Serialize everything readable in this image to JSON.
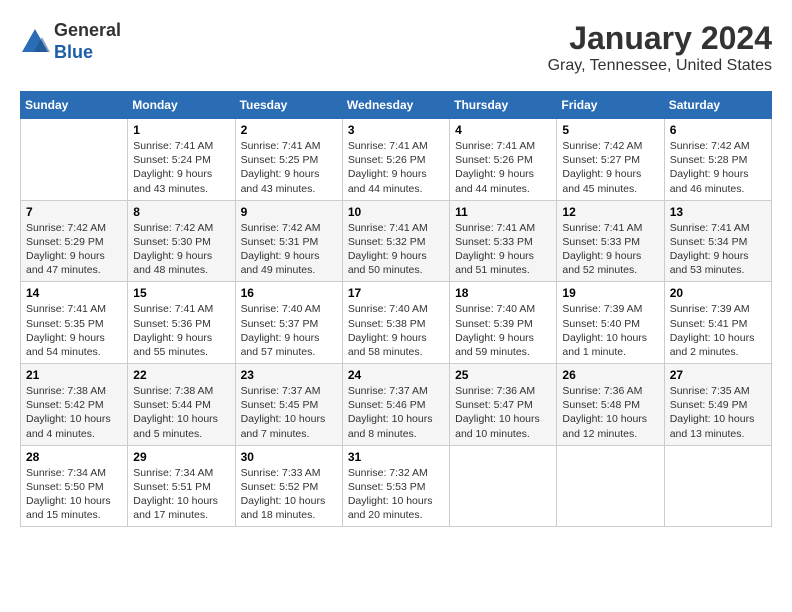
{
  "header": {
    "logo_general": "General",
    "logo_blue": "Blue",
    "month_title": "January 2024",
    "location": "Gray, Tennessee, United States"
  },
  "calendar": {
    "days_of_week": [
      "Sunday",
      "Monday",
      "Tuesday",
      "Wednesday",
      "Thursday",
      "Friday",
      "Saturday"
    ],
    "weeks": [
      [
        {
          "day": "",
          "info": ""
        },
        {
          "day": "1",
          "info": "Sunrise: 7:41 AM\nSunset: 5:24 PM\nDaylight: 9 hours\nand 43 minutes."
        },
        {
          "day": "2",
          "info": "Sunrise: 7:41 AM\nSunset: 5:25 PM\nDaylight: 9 hours\nand 43 minutes."
        },
        {
          "day": "3",
          "info": "Sunrise: 7:41 AM\nSunset: 5:26 PM\nDaylight: 9 hours\nand 44 minutes."
        },
        {
          "day": "4",
          "info": "Sunrise: 7:41 AM\nSunset: 5:26 PM\nDaylight: 9 hours\nand 44 minutes."
        },
        {
          "day": "5",
          "info": "Sunrise: 7:42 AM\nSunset: 5:27 PM\nDaylight: 9 hours\nand 45 minutes."
        },
        {
          "day": "6",
          "info": "Sunrise: 7:42 AM\nSunset: 5:28 PM\nDaylight: 9 hours\nand 46 minutes."
        }
      ],
      [
        {
          "day": "7",
          "info": "Sunrise: 7:42 AM\nSunset: 5:29 PM\nDaylight: 9 hours\nand 47 minutes."
        },
        {
          "day": "8",
          "info": "Sunrise: 7:42 AM\nSunset: 5:30 PM\nDaylight: 9 hours\nand 48 minutes."
        },
        {
          "day": "9",
          "info": "Sunrise: 7:42 AM\nSunset: 5:31 PM\nDaylight: 9 hours\nand 49 minutes."
        },
        {
          "day": "10",
          "info": "Sunrise: 7:41 AM\nSunset: 5:32 PM\nDaylight: 9 hours\nand 50 minutes."
        },
        {
          "day": "11",
          "info": "Sunrise: 7:41 AM\nSunset: 5:33 PM\nDaylight: 9 hours\nand 51 minutes."
        },
        {
          "day": "12",
          "info": "Sunrise: 7:41 AM\nSunset: 5:33 PM\nDaylight: 9 hours\nand 52 minutes."
        },
        {
          "day": "13",
          "info": "Sunrise: 7:41 AM\nSunset: 5:34 PM\nDaylight: 9 hours\nand 53 minutes."
        }
      ],
      [
        {
          "day": "14",
          "info": "Sunrise: 7:41 AM\nSunset: 5:35 PM\nDaylight: 9 hours\nand 54 minutes."
        },
        {
          "day": "15",
          "info": "Sunrise: 7:41 AM\nSunset: 5:36 PM\nDaylight: 9 hours\nand 55 minutes."
        },
        {
          "day": "16",
          "info": "Sunrise: 7:40 AM\nSunset: 5:37 PM\nDaylight: 9 hours\nand 57 minutes."
        },
        {
          "day": "17",
          "info": "Sunrise: 7:40 AM\nSunset: 5:38 PM\nDaylight: 9 hours\nand 58 minutes."
        },
        {
          "day": "18",
          "info": "Sunrise: 7:40 AM\nSunset: 5:39 PM\nDaylight: 9 hours\nand 59 minutes."
        },
        {
          "day": "19",
          "info": "Sunrise: 7:39 AM\nSunset: 5:40 PM\nDaylight: 10 hours\nand 1 minute."
        },
        {
          "day": "20",
          "info": "Sunrise: 7:39 AM\nSunset: 5:41 PM\nDaylight: 10 hours\nand 2 minutes."
        }
      ],
      [
        {
          "day": "21",
          "info": "Sunrise: 7:38 AM\nSunset: 5:42 PM\nDaylight: 10 hours\nand 4 minutes."
        },
        {
          "day": "22",
          "info": "Sunrise: 7:38 AM\nSunset: 5:44 PM\nDaylight: 10 hours\nand 5 minutes."
        },
        {
          "day": "23",
          "info": "Sunrise: 7:37 AM\nSunset: 5:45 PM\nDaylight: 10 hours\nand 7 minutes."
        },
        {
          "day": "24",
          "info": "Sunrise: 7:37 AM\nSunset: 5:46 PM\nDaylight: 10 hours\nand 8 minutes."
        },
        {
          "day": "25",
          "info": "Sunrise: 7:36 AM\nSunset: 5:47 PM\nDaylight: 10 hours\nand 10 minutes."
        },
        {
          "day": "26",
          "info": "Sunrise: 7:36 AM\nSunset: 5:48 PM\nDaylight: 10 hours\nand 12 minutes."
        },
        {
          "day": "27",
          "info": "Sunrise: 7:35 AM\nSunset: 5:49 PM\nDaylight: 10 hours\nand 13 minutes."
        }
      ],
      [
        {
          "day": "28",
          "info": "Sunrise: 7:34 AM\nSunset: 5:50 PM\nDaylight: 10 hours\nand 15 minutes."
        },
        {
          "day": "29",
          "info": "Sunrise: 7:34 AM\nSunset: 5:51 PM\nDaylight: 10 hours\nand 17 minutes."
        },
        {
          "day": "30",
          "info": "Sunrise: 7:33 AM\nSunset: 5:52 PM\nDaylight: 10 hours\nand 18 minutes."
        },
        {
          "day": "31",
          "info": "Sunrise: 7:32 AM\nSunset: 5:53 PM\nDaylight: 10 hours\nand 20 minutes."
        },
        {
          "day": "",
          "info": ""
        },
        {
          "day": "",
          "info": ""
        },
        {
          "day": "",
          "info": ""
        }
      ]
    ]
  }
}
